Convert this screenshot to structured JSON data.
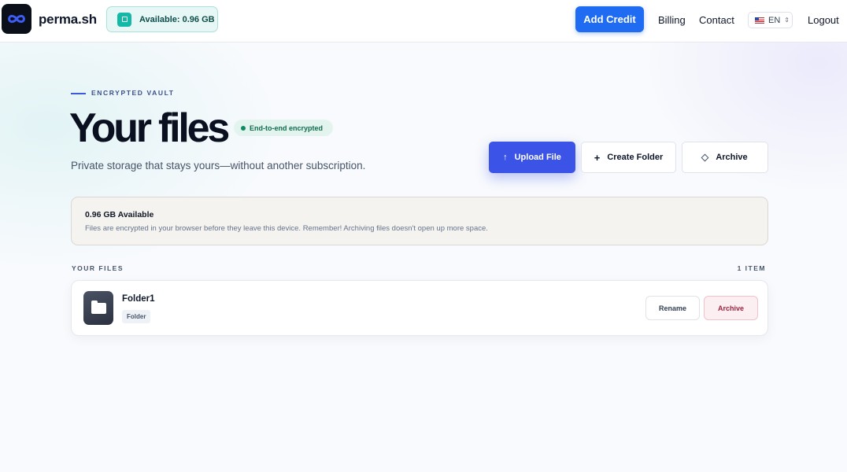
{
  "header": {
    "brand": "perma.sh",
    "availability": "Available: 0.96 GB",
    "add_credit": "Add Credit",
    "nav": [
      "Billing",
      "Contact"
    ],
    "language": "EN",
    "logout": "Logout"
  },
  "hero": {
    "eyebrow": "ENCRYPTED VAULT",
    "title": "Your files",
    "badge": "End-to-end encrypted",
    "subtitle": "Private storage that stays yours—without another subscription.",
    "actions": {
      "upload": "Upload File",
      "create_folder": "Create Folder",
      "archive": "Archive"
    }
  },
  "info": {
    "title": "0.96 GB Available",
    "text": "Files are encrypted in your browser before they leave this device. Remember! Archiving files doesn't open up more space."
  },
  "files": {
    "label": "YOUR FILES",
    "count": "1 ITEM",
    "items": [
      {
        "name": "Folder1",
        "type": "Folder",
        "rename": "Rename",
        "archive": "Archive"
      }
    ]
  },
  "icons": {
    "logo": "infinity-icon",
    "availability": "storage-icon",
    "upload": "arrow-up-icon",
    "create": "plus-icon",
    "archive": "diamond-icon",
    "folder": "folder-icon",
    "language": "us-flag-icon"
  },
  "colors": {
    "primary": "#1f6bf2",
    "upload": "#3b53e6",
    "teal": "#14b8a6",
    "danger": "#9f2440"
  }
}
